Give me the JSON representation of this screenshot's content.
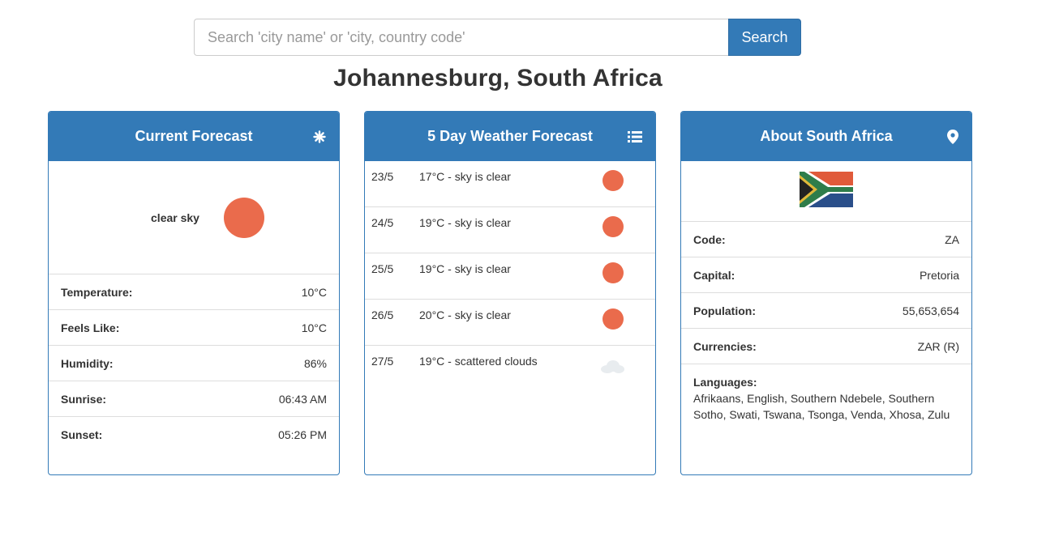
{
  "search": {
    "placeholder": "Search 'city name' or 'city, country code'",
    "button_label": "Search"
  },
  "location": {
    "title": "Johannesburg, South Africa"
  },
  "current": {
    "heading": "Current Forecast",
    "icon": "snowflake-icon",
    "description": "clear sky",
    "weather_icon": "sun-icon",
    "rows": [
      {
        "label": "Temperature:",
        "value": "10°C"
      },
      {
        "label": "Feels Like:",
        "value": "10°C"
      },
      {
        "label": "Humidity:",
        "value": "86%"
      },
      {
        "label": "Sunrise:",
        "value": "06:43 AM"
      },
      {
        "label": "Sunset:",
        "value": "05:26 PM"
      }
    ]
  },
  "forecast": {
    "heading": "5 Day Weather Forecast",
    "icon": "list-icon",
    "days": [
      {
        "date": "23/5",
        "summary": "17°C - sky is clear",
        "icon": "sun-icon"
      },
      {
        "date": "24/5",
        "summary": "19°C - sky is clear",
        "icon": "sun-icon"
      },
      {
        "date": "25/5",
        "summary": "19°C - sky is clear",
        "icon": "sun-icon"
      },
      {
        "date": "26/5",
        "summary": "20°C - sky is clear",
        "icon": "sun-icon"
      },
      {
        "date": "27/5",
        "summary": "19°C - scattered clouds",
        "icon": "cloud-icon"
      }
    ]
  },
  "about": {
    "heading": "About South Africa",
    "icon": "map-marker-icon",
    "flag": "south-africa-flag",
    "rows": [
      {
        "label": "Code:",
        "value": "ZA"
      },
      {
        "label": "Capital:",
        "value": "Pretoria"
      },
      {
        "label": "Population:",
        "value": "55,653,654"
      },
      {
        "label": "Currencies:",
        "value": "ZAR (R)"
      }
    ],
    "languages_label": "Languages:",
    "languages_value": "Afrikaans, English, Southern Ndebele, Southern Sotho, Swati, Tswana, Tsonga, Venda, Xhosa, Zulu"
  },
  "colors": {
    "primary": "#337ab7",
    "sun": "#ea6b4c",
    "border": "#dddddd"
  }
}
